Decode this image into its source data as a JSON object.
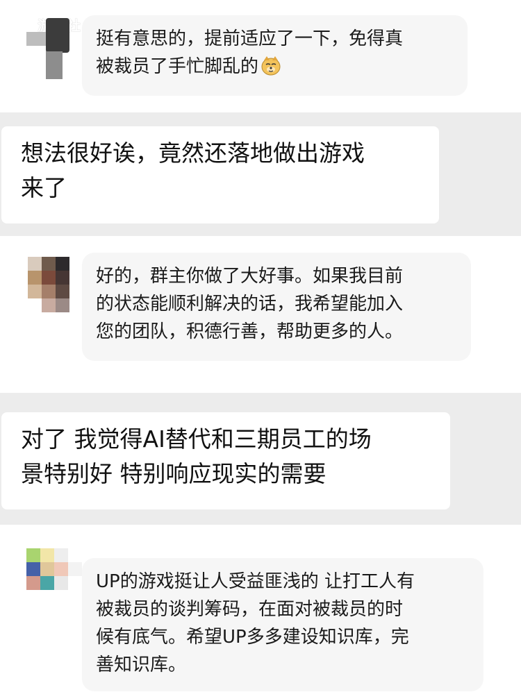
{
  "watermark": {
    "text": "游研社"
  },
  "messages": [
    {
      "lines": [
        "挺有意思的，提前适应了一下，免得真",
        "被裁员了手忙脚乱的"
      ],
      "emoji": "sly-dog-emoji-icon"
    },
    {
      "lines": [
        "想法很好诶，竟然还落地做出游戏",
        "来了"
      ]
    },
    {
      "lines": [
        "好的，群主你做了大好事。如果我目前",
        "的状态能顺利解决的话，我希望能加入",
        "您的团队，积德行善，帮助更多的人。"
      ]
    },
    {
      "lines": [
        "对了 我觉得AI替代和三期员工的场",
        "景特别好 特别响应现实的需要"
      ]
    },
    {
      "lines": [
        "UP的游戏挺让人受益匪浅的 让打工人有",
        "被裁员的谈判筹码，在面对被裁员的时",
        "候有底气。希望UP多多建设知识库，完",
        "善知识库。"
      ]
    }
  ],
  "colors": {
    "band": "#ececec",
    "bubble": "#f6f6f6",
    "card": "#ffffff",
    "text": "#1a1a1a"
  }
}
